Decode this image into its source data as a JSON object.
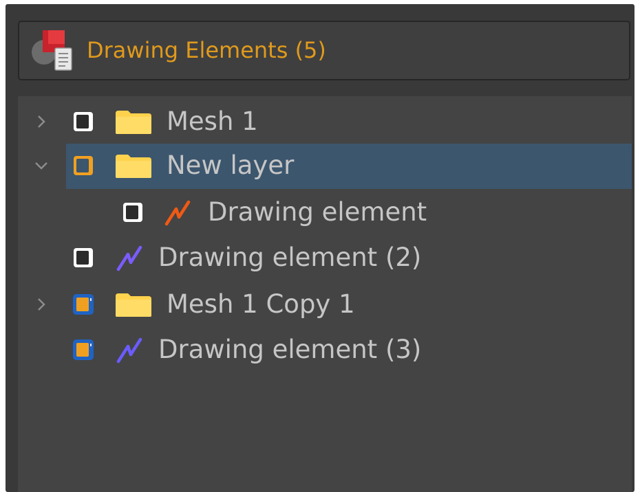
{
  "panel": {
    "title": "Drawing Elements (5)",
    "title_color": "#e09a1c",
    "icon": "drawing-elements-icon"
  },
  "tree": {
    "rows": [
      {
        "label": "Mesh 1",
        "type": "folder",
        "expander": "collapsed",
        "visibility": "unchecked",
        "selected": false,
        "depth": 0
      },
      {
        "label": "New layer",
        "type": "folder",
        "expander": "expanded",
        "visibility": "highlighted",
        "selected": true,
        "depth": 0
      },
      {
        "label": "Drawing element",
        "type": "drawing",
        "stroke_color": "#f05a14",
        "visibility": "unchecked",
        "selected": false,
        "depth": 1
      },
      {
        "label": "Drawing element (2)",
        "type": "drawing",
        "stroke_color": "#7b5cff",
        "visibility": "unchecked",
        "selected": false,
        "depth": 0
      },
      {
        "label": "Mesh 1 Copy 1",
        "type": "folder",
        "expander": "collapsed",
        "visibility": "checked",
        "selected": false,
        "depth": 0
      },
      {
        "label": "Drawing element (3)",
        "type": "drawing",
        "stroke_color": "#6a5cff",
        "visibility": "checked",
        "selected": false,
        "depth": 0
      }
    ],
    "selection_color": "#3c566e",
    "folder_color": "#ffd24d"
  }
}
